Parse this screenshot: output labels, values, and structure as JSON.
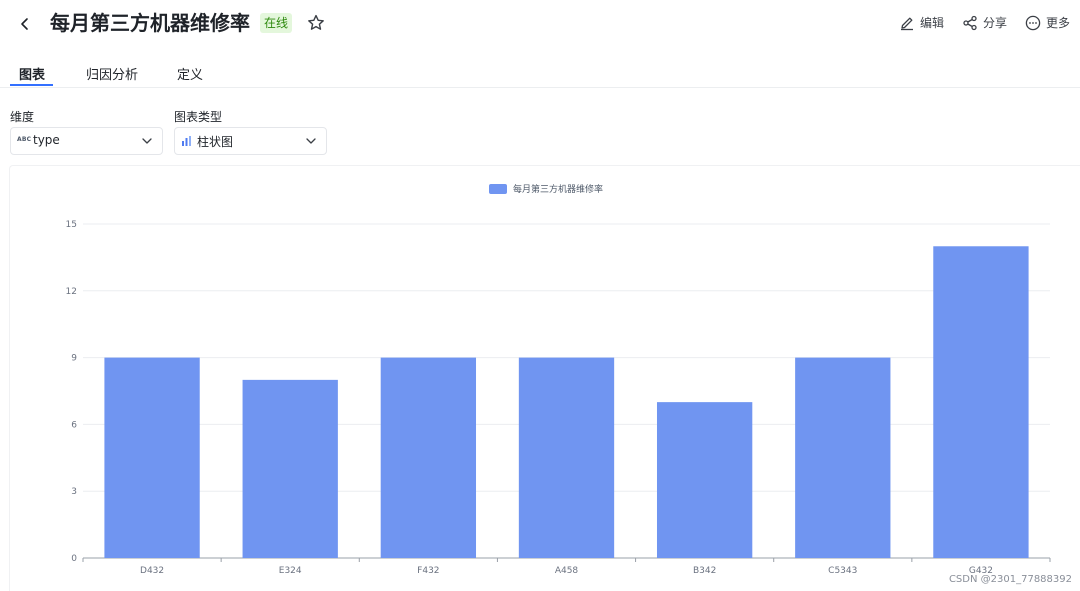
{
  "header": {
    "title": "每月第三方机器维修率",
    "status": "在线",
    "actions": {
      "edit": "编辑",
      "share": "分享",
      "more": "更多"
    }
  },
  "tabs": [
    {
      "label": "图表",
      "active": true
    },
    {
      "label": "归因分析",
      "active": false
    },
    {
      "label": "定义",
      "active": false
    }
  ],
  "filters": {
    "dimension": {
      "label": "维度",
      "icon_text": "ABC",
      "value": "type"
    },
    "chart_type": {
      "label": "图表类型",
      "value": "柱状图"
    }
  },
  "colors": {
    "bar": "#7095f1",
    "accent": "#3370ff",
    "status_bg": "#e4f7dc",
    "status_text": "#2e8a0e"
  },
  "chart_data": {
    "type": "bar",
    "title": "",
    "xlabel": "",
    "ylabel": "",
    "legend_position": "top-center",
    "grid": true,
    "ylim": [
      0,
      15
    ],
    "yticks": [
      0,
      3,
      6,
      9,
      12,
      15
    ],
    "categories": [
      "D432",
      "E324",
      "F432",
      "A458",
      "B342",
      "C5343",
      "G432"
    ],
    "series": [
      {
        "name": "每月第三方机器维修率",
        "values": [
          9,
          8,
          9,
          9,
          7,
          9,
          14
        ]
      }
    ]
  },
  "watermark": "CSDN @2301_77888392"
}
